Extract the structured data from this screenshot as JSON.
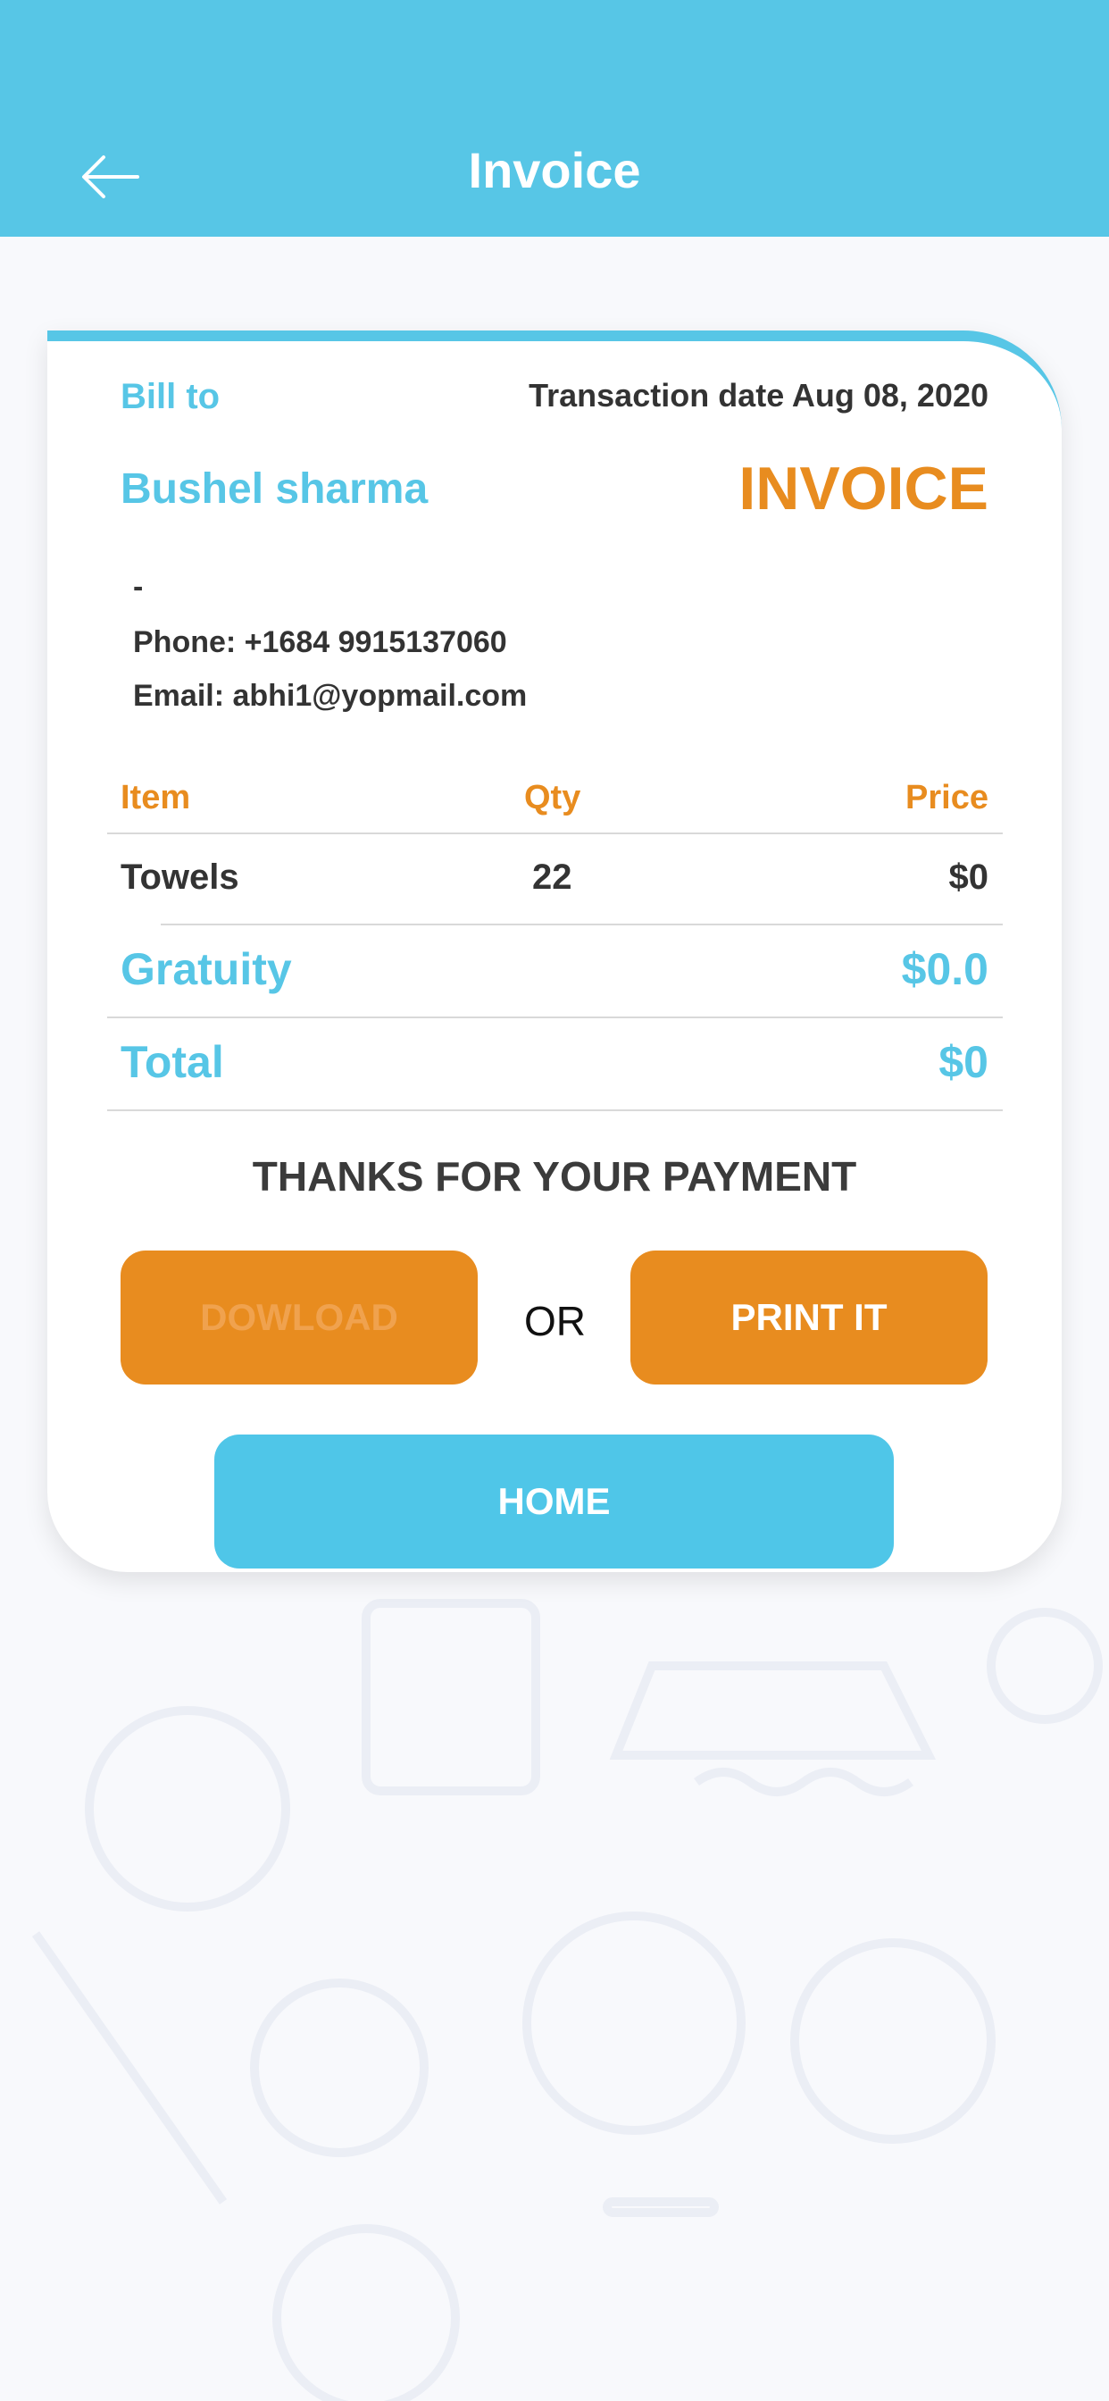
{
  "header": {
    "title": "Invoice",
    "back_icon": "arrow-left-icon"
  },
  "invoice": {
    "bill_to_label": "Bill to",
    "transaction_date": "Transaction date Aug 08, 2020",
    "customer_name": "Bushel sharma",
    "invoice_label": "INVOICE",
    "address": "-",
    "phone": "Phone: +1684 9915137060",
    "email": "Email: abhi1@yopmail.com",
    "columns": {
      "item": "Item",
      "qty": "Qty",
      "price": "Price"
    },
    "rows": [
      {
        "item": "Towels",
        "qty": "22",
        "price": "$0"
      }
    ],
    "gratuity_label": "Gratuity",
    "gratuity_value": "$0.0",
    "total_label": "Total",
    "total_value": "$0",
    "thanks_message": "THANKS FOR YOUR PAYMENT"
  },
  "actions": {
    "download_label": "DOWLOAD",
    "or_label": "OR",
    "print_label": "PRINT IT",
    "home_label": "HOME"
  },
  "colors": {
    "primary_blue": "#57c6e6",
    "accent_orange": "#e88c1f",
    "text_dark": "#333333"
  }
}
